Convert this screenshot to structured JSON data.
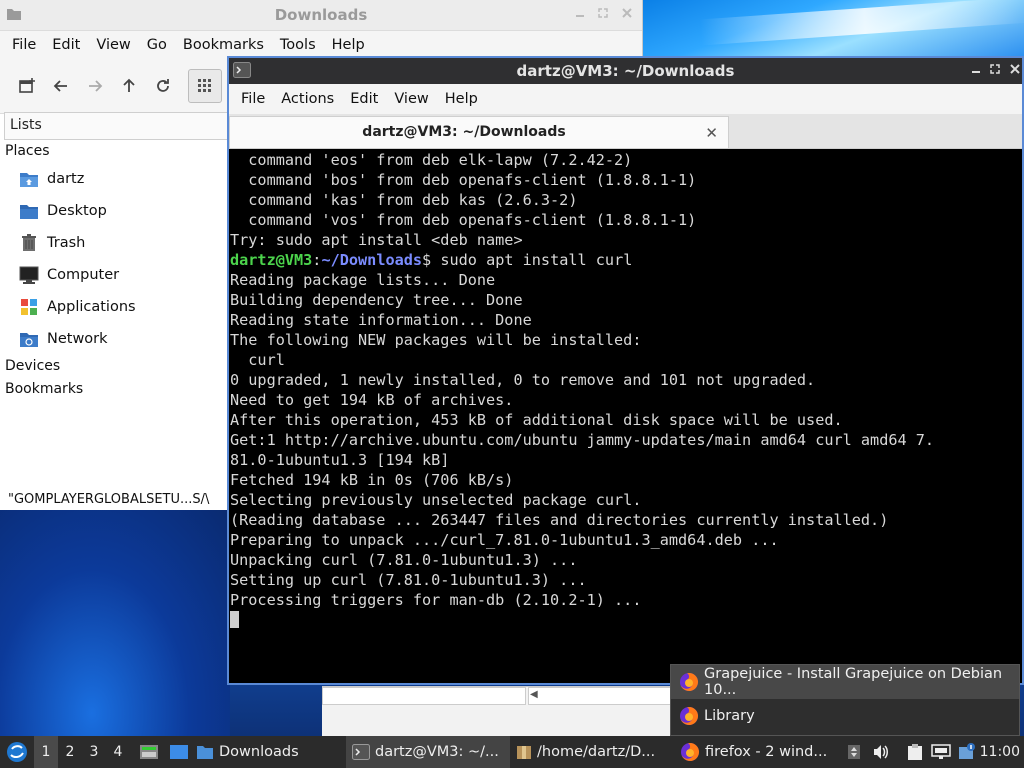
{
  "file_manager": {
    "title": "Downloads",
    "menu": [
      "File",
      "Edit",
      "View",
      "Go",
      "Bookmarks",
      "Tools",
      "Help"
    ],
    "side_header": "Lists",
    "sections": {
      "places": "Places",
      "devices": "Devices",
      "bookmarks": "Bookmarks"
    },
    "places": [
      {
        "label": "dartz",
        "icon": "home-folder-icon"
      },
      {
        "label": "Desktop",
        "icon": "desktop-folder-icon"
      },
      {
        "label": "Trash",
        "icon": "trash-icon"
      },
      {
        "label": "Computer",
        "icon": "computer-icon"
      },
      {
        "label": "Applications",
        "icon": "applications-icon"
      },
      {
        "label": "Network",
        "icon": "network-icon"
      }
    ],
    "status": "\"GOMPLAYERGLOBALSETU...S/\\"
  },
  "terminal": {
    "title": "dartz@VM3: ~/Downloads",
    "menu": [
      "File",
      "Actions",
      "Edit",
      "View",
      "Help"
    ],
    "tab_label": "dartz@VM3: ~/Downloads",
    "prompt": {
      "user": "dartz@VM3",
      "sep": ":",
      "path": "~/Downloads",
      "dollar": "$",
      "command": " sudo apt install curl"
    },
    "lines_before": [
      "  command 'eos' from deb elk-lapw (7.2.42-2)",
      "  command 'bos' from deb openafs-client (1.8.8.1-1)",
      "  command 'kas' from deb kas (2.6.3-2)",
      "  command 'vos' from deb openafs-client (1.8.8.1-1)",
      "Try: sudo apt install <deb name>"
    ],
    "lines_after": [
      "Reading package lists... Done",
      "Building dependency tree... Done",
      "Reading state information... Done",
      "The following NEW packages will be installed:",
      "  curl",
      "0 upgraded, 1 newly installed, 0 to remove and 101 not upgraded.",
      "Need to get 194 kB of archives.",
      "After this operation, 453 kB of additional disk space will be used.",
      "Get:1 http://archive.ubuntu.com/ubuntu jammy-updates/main amd64 curl amd64 7.",
      "81.0-1ubuntu1.3 [194 kB]",
      "Fetched 194 kB in 0s (706 kB/s)",
      "Selecting previously unselected package curl.",
      "(Reading database ... 263447 files and directories currently installed.)",
      "Preparing to unpack .../curl_7.81.0-1ubuntu1.3_amd64.deb ...",
      "Unpacking curl (7.81.0-1ubuntu1.3) ...",
      "Setting up curl (7.81.0-1ubuntu1.3) ...",
      "Processing triggers for man-db (2.10.2-1) ..."
    ]
  },
  "popup": {
    "items": [
      "Grapejuice - Install Grapejuice on Debian 10...",
      "Library"
    ]
  },
  "panel": {
    "workspaces": [
      "1",
      "2",
      "3",
      "4"
    ],
    "tasks": {
      "downloads": "Downloads",
      "terminal": "dartz@VM3: ~/...",
      "home": "/home/dartz/D...",
      "firefox": "firefox - 2 wind..."
    },
    "clock": "11:00"
  },
  "colors": {
    "prompt_user": "#4cd44c",
    "prompt_path": "#7b8cff",
    "terminal_border": "#5a8ad6",
    "panel_bg": "#2b2b2b"
  }
}
